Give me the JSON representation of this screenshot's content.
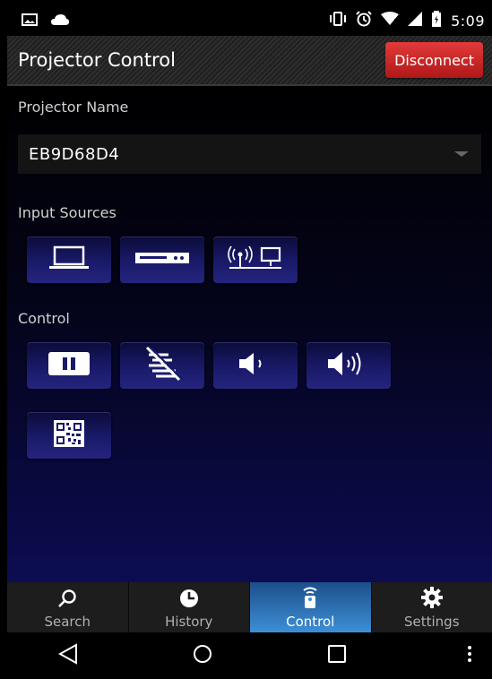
{
  "status_bar": {
    "time": "5:09",
    "left_icons": [
      "image-icon",
      "cloud-icon"
    ],
    "right_icons": [
      "vibrate-icon",
      "alarm-icon",
      "wifi-icon",
      "signal-icon",
      "battery-icon"
    ]
  },
  "header": {
    "title": "Projector Control",
    "disconnect_label": "Disconnect",
    "disconnect_color": "#d42a2a"
  },
  "projector": {
    "label": "Projector Name",
    "selected": "EB9D68D4"
  },
  "input_sources": {
    "label": "Input Sources",
    "buttons": [
      "laptop-icon",
      "set-top-box-icon",
      "wireless-lan-icon"
    ]
  },
  "control": {
    "label": "Control",
    "buttons": [
      "pause-icon",
      "av-mute-icon",
      "volume-down-icon",
      "volume-up-icon",
      "qr-code-icon"
    ]
  },
  "tabs": [
    {
      "label": "Search",
      "icon": "search-icon",
      "active": false
    },
    {
      "label": "History",
      "icon": "history-icon",
      "active": false
    },
    {
      "label": "Control",
      "icon": "remote-icon",
      "active": true
    },
    {
      "label": "Settings",
      "icon": "gear-icon",
      "active": false
    }
  ],
  "navigation": [
    "back-icon",
    "home-icon",
    "recents-icon",
    "menu-icon"
  ],
  "colors": {
    "accent": "#3d8fd6",
    "button_bg": "#1a1a6a",
    "background_bottom": "#0c0c52"
  }
}
